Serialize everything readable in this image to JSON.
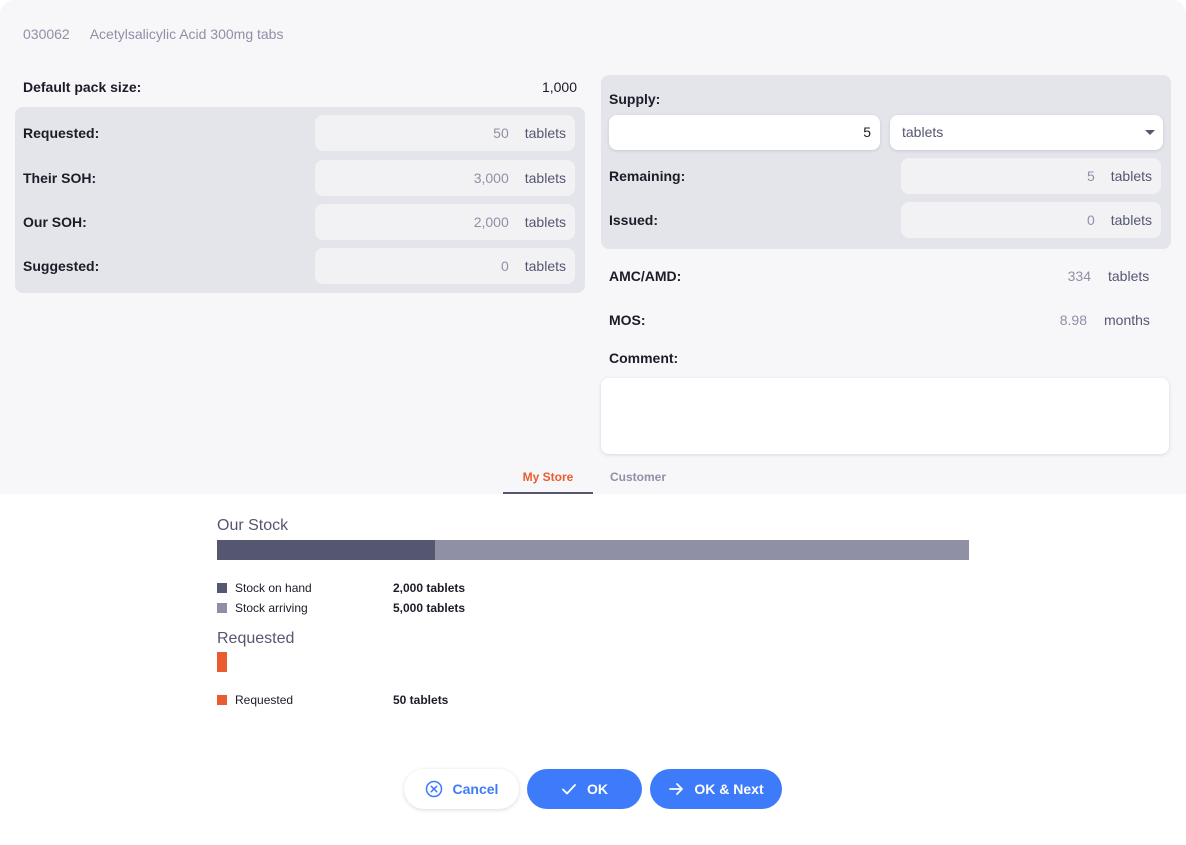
{
  "header": {
    "code": "030062",
    "name": "Acetylsalicylic Acid 300mg tabs"
  },
  "left": {
    "pack_label": "Default pack size:",
    "pack_value": "1,000",
    "rows": [
      {
        "label": "Requested:",
        "value": "50",
        "unit": "tablets"
      },
      {
        "label": "Their SOH:",
        "value": "3,000",
        "unit": "tablets"
      },
      {
        "label": "Our SOH:",
        "value": "2,000",
        "unit": "tablets"
      },
      {
        "label": "Suggested:",
        "value": "0",
        "unit": "tablets"
      }
    ]
  },
  "right": {
    "supply_label": "Supply:",
    "supply_value": "5",
    "supply_unit_selected": "tablets",
    "remaining_label": "Remaining:",
    "remaining_value": "5",
    "remaining_unit": "tablets",
    "issued_label": "Issued:",
    "issued_value": "0",
    "issued_unit": "tablets",
    "amc_label": "AMC/AMD:",
    "amc_value": "334",
    "amc_unit": "tablets",
    "mos_label": "MOS:",
    "mos_value": "8.98",
    "mos_unit": "months",
    "comment_label": "Comment:",
    "comment_value": ""
  },
  "tabs": [
    {
      "label": "My Store",
      "active": true
    },
    {
      "label": "Customer",
      "active": false
    }
  ],
  "stock": {
    "title": "Our Stock",
    "stock_on_hand_fraction": 0.29,
    "legend": [
      {
        "name": "Stock on hand",
        "value": "2,000 tablets",
        "color": "#555770"
      },
      {
        "name": "Stock arriving",
        "value": "5,000 tablets",
        "color": "#8f90a6"
      }
    ]
  },
  "requested": {
    "title": "Requested",
    "legend": [
      {
        "name": "Requested",
        "value": "50 tablets",
        "color": "#e95c30"
      }
    ]
  },
  "buttons": {
    "cancel": "Cancel",
    "ok": "OK",
    "ok_next": "OK & Next"
  },
  "colors": {
    "accent": "#3e7bfa",
    "requested": "#e95c30",
    "panel": "#e4e4eb"
  }
}
